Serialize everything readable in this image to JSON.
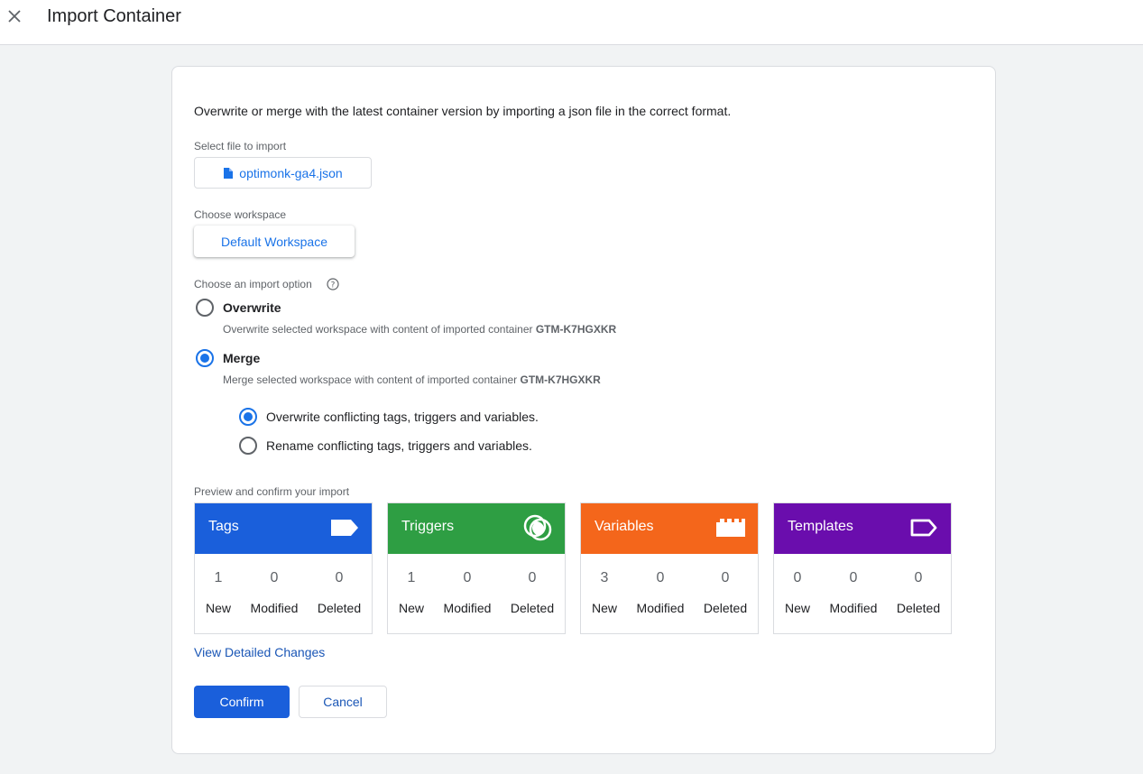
{
  "header": {
    "title": "Import Container",
    "close_icon": "close-icon"
  },
  "intro": "Overwrite or merge with the latest container version by importing a json file in the correct format.",
  "file": {
    "label": "Select file to import",
    "filename": "optimonk-ga4.json",
    "icon": "file-icon"
  },
  "workspace": {
    "label": "Choose workspace",
    "value": "Default Workspace"
  },
  "import_option": {
    "label": "Choose an import option",
    "help_icon": "help-icon",
    "options": [
      {
        "title": "Overwrite",
        "desc": "Overwrite selected workspace with content of imported container",
        "container": "GTM-K7HGXKR",
        "selected": false
      },
      {
        "title": "Merge",
        "desc": "Merge selected workspace with content of imported container",
        "container": "GTM-K7HGXKR",
        "selected": true
      }
    ],
    "merge_options": [
      {
        "label": "Overwrite conflicting tags, triggers and variables.",
        "selected": true
      },
      {
        "label": "Rename conflicting tags, triggers and variables.",
        "selected": false
      }
    ]
  },
  "preview": {
    "label": "Preview and confirm your import",
    "stat_labels": [
      "New",
      "Modified",
      "Deleted"
    ],
    "cards": [
      {
        "name": "Tags",
        "color": "#1a5fdb",
        "icon": "tag-icon",
        "values": [
          "1",
          "0",
          "0"
        ]
      },
      {
        "name": "Triggers",
        "color": "#2e9e43",
        "icon": "trigger-icon",
        "values": [
          "1",
          "0",
          "0"
        ]
      },
      {
        "name": "Variables",
        "color": "#f4661b",
        "icon": "variable-block-icon",
        "values": [
          "3",
          "0",
          "0"
        ]
      },
      {
        "name": "Templates",
        "color": "#6a0dad",
        "icon": "template-tag-icon",
        "values": [
          "0",
          "0",
          "0"
        ]
      }
    ]
  },
  "view_changes": "View Detailed Changes",
  "actions": {
    "confirm": "Confirm",
    "cancel": "Cancel"
  }
}
